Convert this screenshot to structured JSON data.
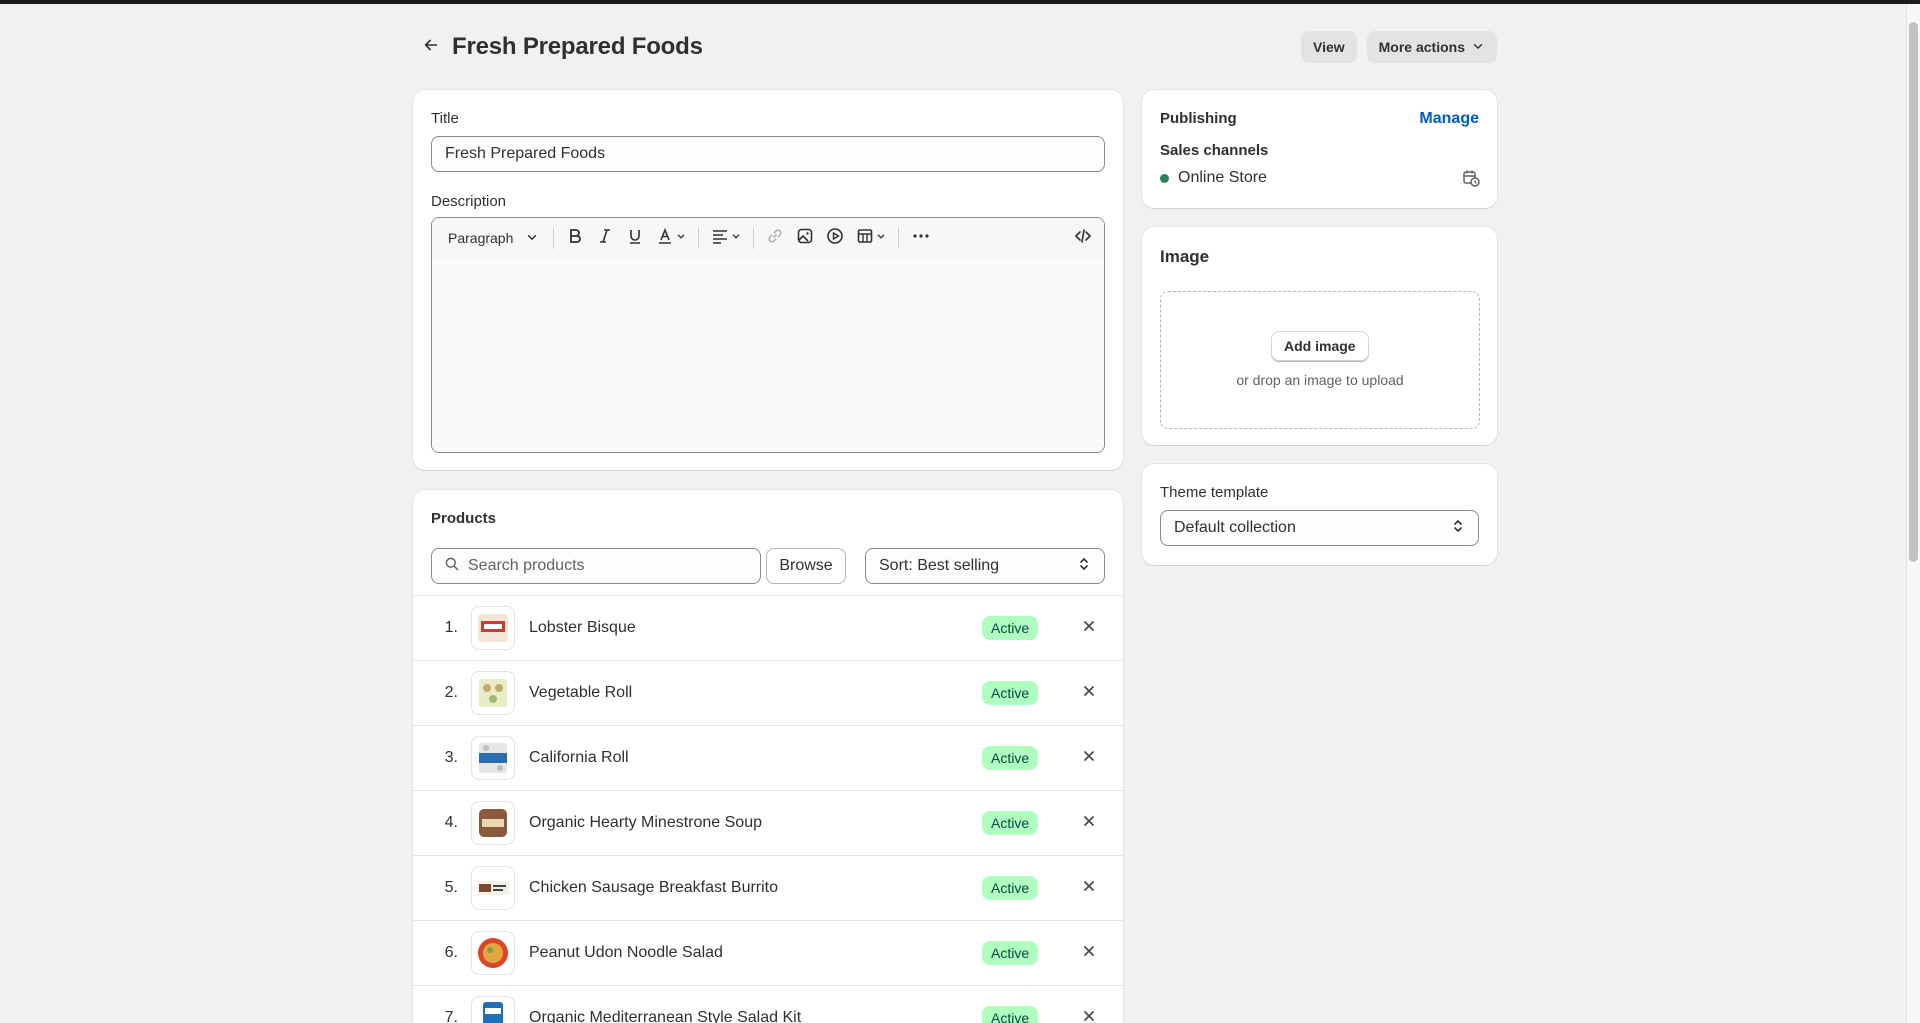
{
  "header": {
    "title": "Fresh Prepared Foods",
    "view_label": "View",
    "more_actions_label": "More actions"
  },
  "main": {
    "title_label": "Title",
    "title_value": "Fresh Prepared Foods",
    "description_label": "Description",
    "editor": {
      "paragraph_label": "Paragraph"
    }
  },
  "products": {
    "heading": "Products",
    "search_placeholder": "Search products",
    "browse_label": "Browse",
    "sort_label": "Sort: Best selling",
    "status_color": "#affebf",
    "items": [
      {
        "num": "1.",
        "name": "Lobster Bisque",
        "status": "Active"
      },
      {
        "num": "2.",
        "name": "Vegetable Roll",
        "status": "Active"
      },
      {
        "num": "3.",
        "name": "California Roll",
        "status": "Active"
      },
      {
        "num": "4.",
        "name": "Organic Hearty Minestrone Soup",
        "status": "Active"
      },
      {
        "num": "5.",
        "name": "Chicken Sausage Breakfast Burrito",
        "status": "Active"
      },
      {
        "num": "6.",
        "name": "Peanut Udon Noodle Salad",
        "status": "Active"
      },
      {
        "num": "7.",
        "name": "Organic Mediterranean Style Salad Kit",
        "status": "Active"
      }
    ]
  },
  "publishing": {
    "heading": "Publishing",
    "manage_label": "Manage",
    "sales_channels_label": "Sales channels",
    "channel_name": "Online Store",
    "channel_status_color": "#29845a"
  },
  "image": {
    "heading": "Image",
    "add_label": "Add image",
    "drop_hint": "or drop an image to upload"
  },
  "theme": {
    "label": "Theme template",
    "value": "Default collection"
  }
}
